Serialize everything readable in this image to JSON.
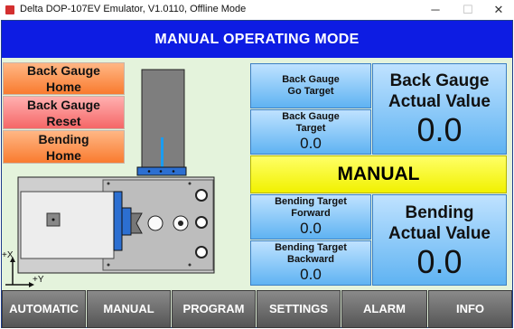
{
  "window": {
    "title": "Delta DOP-107EV Emulator, V1.0110, Offline Mode",
    "minimize_glyph": "─",
    "maximize_glyph": "☐",
    "close_glyph": "✕"
  },
  "header": {
    "title": "MANUAL OPERATING MODE"
  },
  "left_buttons": {
    "back_gauge_home": {
      "line1": "Back Gauge",
      "line2": "Home"
    },
    "back_gauge_reset": {
      "line1": "Back Gauge",
      "line2": "Reset"
    },
    "bending_home": {
      "line1": "Bending",
      "line2": "Home"
    }
  },
  "axes": {
    "x_label": "+X",
    "y_label": "+Y"
  },
  "back_gauge": {
    "go_target": {
      "line1": "Back Gauge",
      "line2": "Go Target"
    },
    "target": {
      "line1": "Back Gauge",
      "line2": "Target",
      "value": "0.0"
    },
    "actual": {
      "line1": "Back Gauge",
      "line2": "Actual Value",
      "value": "0.0"
    }
  },
  "mode_banner": "MANUAL",
  "bending": {
    "target_forward": {
      "line1": "Bending Target",
      "line2": "Forward",
      "value": "0.0"
    },
    "target_backward": {
      "line1": "Bending Target",
      "line2": "Backward",
      "value": "0.0"
    },
    "actual": {
      "line1": "Bending",
      "line2": "Actual Value",
      "value": "0.0"
    }
  },
  "nav": [
    "AUTOMATIC",
    "MANUAL",
    "PROGRAM",
    "SETTINGS",
    "ALARM",
    "INFO"
  ],
  "colors": {
    "header_bg": "#0d1ce3",
    "panel_bg": "#e4f3dc",
    "banner_yellow": "#f1f100",
    "button_blue": "#5fb3f2",
    "button_orange": "#f97b2f",
    "button_pink": "#f56767",
    "nav_gray": "#6b6b6b"
  }
}
